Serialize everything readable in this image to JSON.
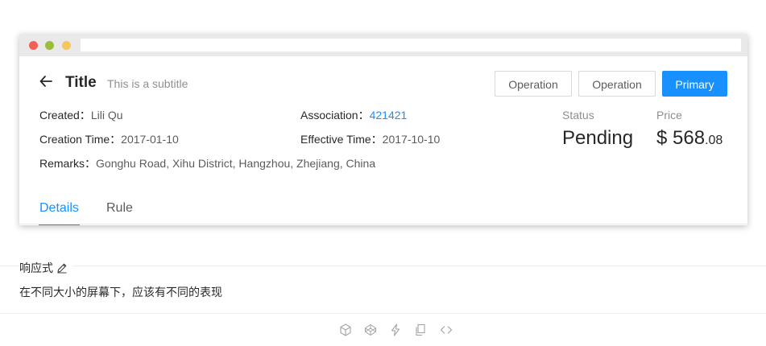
{
  "header": {
    "title": "Title",
    "subtitle": "This is a subtitle",
    "buttons": {
      "operation_1": "Operation",
      "operation_2": "Operation",
      "primary": "Primary"
    }
  },
  "details": {
    "created_label": "Created：",
    "created_value": "Lili Qu",
    "association_label": "Association：",
    "association_value": "421421",
    "creation_time_label": "Creation Time：",
    "creation_time_value": "2017-01-10",
    "effective_time_label": "Effective Time：",
    "effective_time_value": "2017-10-10",
    "remarks_label": "Remarks：",
    "remarks_value": "Gonghu Road, Xihu District, Hangzhou, Zhejiang, China"
  },
  "stats": {
    "status_label": "Status",
    "status_value": "Pending",
    "price_label": "Price",
    "price_main": "$ 568",
    "price_cents": ".08"
  },
  "tabs": [
    {
      "label": "Details",
      "active": true
    },
    {
      "label": "Rule",
      "active": false
    }
  ],
  "section": {
    "title": "响应式",
    "description": "在不同大小的屏幕下，应该有不同的表现"
  },
  "icons": {
    "back": "arrow-left-icon",
    "edit": "edit-icon",
    "actions": [
      "codesandbox-icon",
      "codepen-icon",
      "thunderbolt-icon",
      "copy-icon",
      "code-icon"
    ]
  },
  "colors": {
    "primary": "#1890ff",
    "window_red": "#f25f56",
    "window_yellow": "#9bbd3a",
    "window_green": "#f6c65c"
  }
}
